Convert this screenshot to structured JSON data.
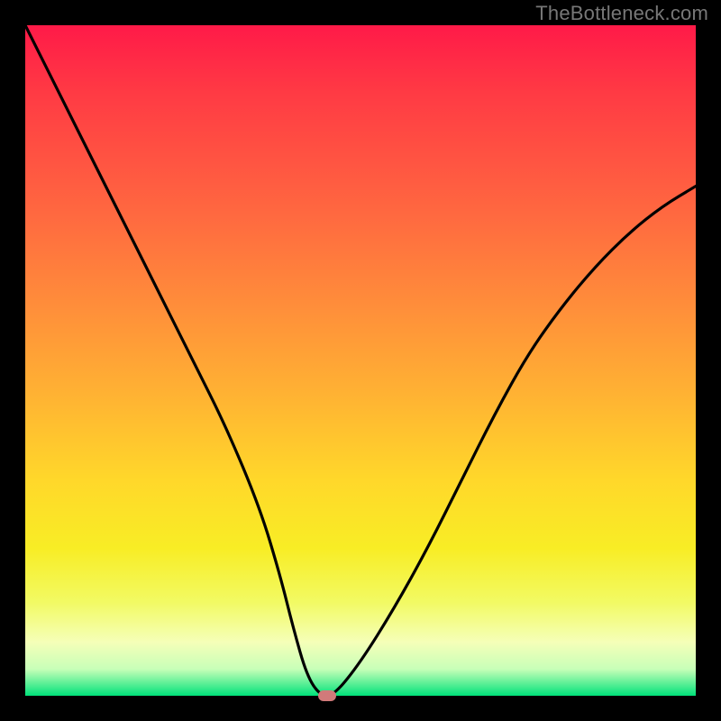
{
  "attribution": "TheBottleneck.com",
  "chart_data": {
    "type": "line",
    "title": "",
    "xlabel": "",
    "ylabel": "",
    "xlim": [
      0,
      100
    ],
    "ylim": [
      0,
      100
    ],
    "grid": false,
    "legend": false,
    "series": [
      {
        "name": "bottleneck-curve",
        "x": [
          0,
          5,
          10,
          15,
          20,
          25,
          30,
          35,
          38,
          40,
          42,
          44,
          46,
          50,
          55,
          60,
          65,
          70,
          75,
          80,
          85,
          90,
          95,
          100
        ],
        "values": [
          100,
          90,
          80,
          70,
          60,
          50,
          40,
          28,
          18,
          10,
          3,
          0,
          0,
          5,
          13,
          22,
          32,
          42,
          51,
          58,
          64,
          69,
          73,
          76
        ]
      }
    ],
    "marker": {
      "x": 45,
      "y": 0
    },
    "background_gradient": {
      "top": "#ff1a48",
      "mid_upper": "#ff8e3a",
      "mid": "#ffd82a",
      "mid_lower": "#f5ffb8",
      "bottom": "#00e27a"
    }
  }
}
